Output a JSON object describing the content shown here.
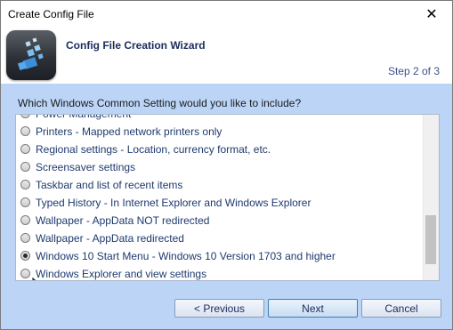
{
  "window": {
    "title": "Create Config File"
  },
  "header": {
    "title": "Config File Creation Wizard",
    "step": "Step 2 of 3"
  },
  "question": "Which Windows Common Setting would you like to include?",
  "options": [
    {
      "label": "Power Management"
    },
    {
      "label": "Printers - Mapped network printers only"
    },
    {
      "label": "Regional settings - Location, currency format, etc."
    },
    {
      "label": "Screensaver settings"
    },
    {
      "label": "Taskbar and list of recent items"
    },
    {
      "label": "Typed History - In Internet Explorer and Windows Explorer"
    },
    {
      "label": "Wallpaper - AppData NOT redirected"
    },
    {
      "label": "Wallpaper - AppData redirected"
    },
    {
      "label": "Windows 10 Start Menu - Windows 10 Version 1703 and higher",
      "selected": true
    },
    {
      "label": "Windows Explorer and view settings"
    }
  ],
  "buttons": {
    "previous": "< Previous",
    "next": "Next",
    "cancel": "Cancel"
  },
  "colors": {
    "panel": "#bcd5f7",
    "text": "#1e3a6e",
    "header_title": "#1c2b5c"
  },
  "icons": {
    "close": "close-icon",
    "app": "app-logo-icon",
    "cursor": "mouse-cursor-icon"
  }
}
